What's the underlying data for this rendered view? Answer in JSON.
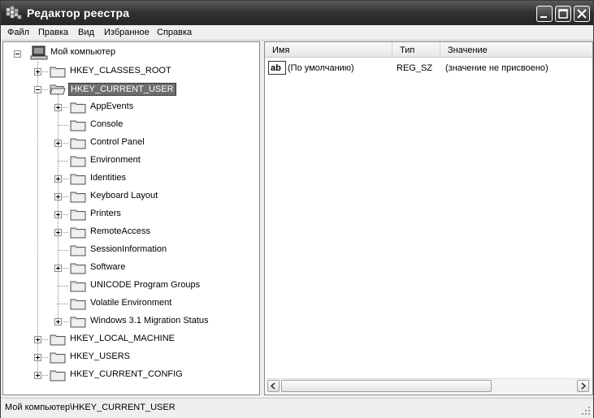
{
  "window": {
    "title": "Редактор реестра"
  },
  "menu": [
    "Файл",
    "Правка",
    "Вид",
    "Избранное",
    "Справка"
  ],
  "tree": {
    "root": "Мой компьютер",
    "hives": [
      {
        "label": "HKEY_CLASSES_ROOT",
        "expanded": false
      },
      {
        "label": "HKEY_CURRENT_USER",
        "expanded": true,
        "selected": true
      },
      {
        "label": "HKEY_LOCAL_MACHINE",
        "expanded": false
      },
      {
        "label": "HKEY_USERS",
        "expanded": false
      },
      {
        "label": "HKEY_CURRENT_CONFIG",
        "expanded": false
      }
    ],
    "hkcu_children": [
      {
        "label": "AppEvents",
        "has_children": true
      },
      {
        "label": "Console",
        "has_children": false
      },
      {
        "label": "Control Panel",
        "has_children": true
      },
      {
        "label": "Environment",
        "has_children": false
      },
      {
        "label": "Identities",
        "has_children": true
      },
      {
        "label": "Keyboard Layout",
        "has_children": true
      },
      {
        "label": "Printers",
        "has_children": true
      },
      {
        "label": "RemoteAccess",
        "has_children": true
      },
      {
        "label": "SessionInformation",
        "has_children": false
      },
      {
        "label": "Software",
        "has_children": true
      },
      {
        "label": "UNICODE Program Groups",
        "has_children": false
      },
      {
        "label": "Volatile Environment",
        "has_children": false
      },
      {
        "label": "Windows 3.1 Migration Status",
        "has_children": true
      }
    ]
  },
  "list": {
    "columns": [
      "Имя",
      "Тип",
      "Значение"
    ],
    "rows": [
      {
        "name": "(По умолчанию)",
        "type": "REG_SZ",
        "value": "(значение не присвоено)",
        "icon": "string-value-icon"
      }
    ]
  },
  "status": {
    "path": "Мой компьютер\\HKEY_CURRENT_USER"
  }
}
